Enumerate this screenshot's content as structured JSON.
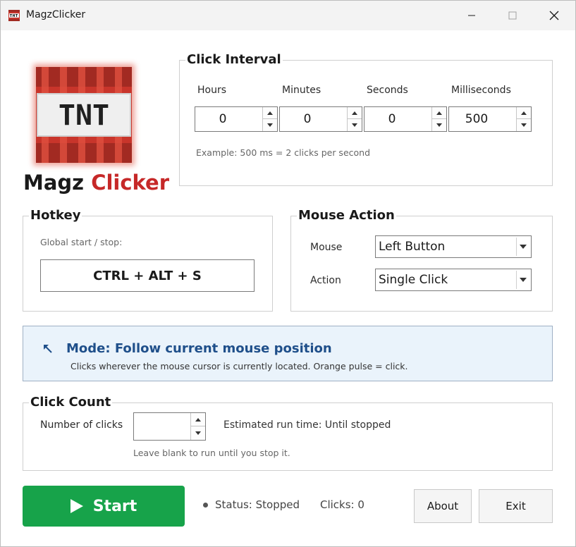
{
  "window": {
    "title": "MagzClicker"
  },
  "brand": {
    "part1": "Magz",
    "part2": "Clicker",
    "logo_text": "TNT"
  },
  "click_interval": {
    "title": "Click Interval",
    "fields": [
      {
        "label": "Hours",
        "value": "0"
      },
      {
        "label": "Minutes",
        "value": "0"
      },
      {
        "label": "Seconds",
        "value": "0"
      },
      {
        "label": "Milliseconds",
        "value": "500"
      }
    ],
    "example": "Example: 500 ms = 2 clicks per second"
  },
  "hotkey": {
    "title": "Hotkey",
    "caption": "Global start / stop:",
    "value": "CTRL + ALT + S"
  },
  "mouse_action": {
    "title": "Mouse Action",
    "mouse_label": "Mouse",
    "mouse_value": "Left Button",
    "action_label": "Action",
    "action_value": "Single Click"
  },
  "mode": {
    "title": "Mode: Follow current mouse position",
    "description": "Clicks wherever the mouse cursor is currently located. Orange pulse = click."
  },
  "click_count": {
    "title": "Click Count",
    "label": "Number of clicks",
    "value": "",
    "estimate": "Estimated run time: Until stopped",
    "hint": "Leave blank to run until you stop it."
  },
  "footer": {
    "start_label": "Start",
    "status": "Status: Stopped",
    "clicks": "Clicks: 0",
    "about_label": "About",
    "exit_label": "Exit"
  },
  "colors": {
    "start_green": "#17a34a",
    "brand_red": "#c62828",
    "mode_blue": "#1f4f8a",
    "mode_bg": "#eaf3fb"
  }
}
